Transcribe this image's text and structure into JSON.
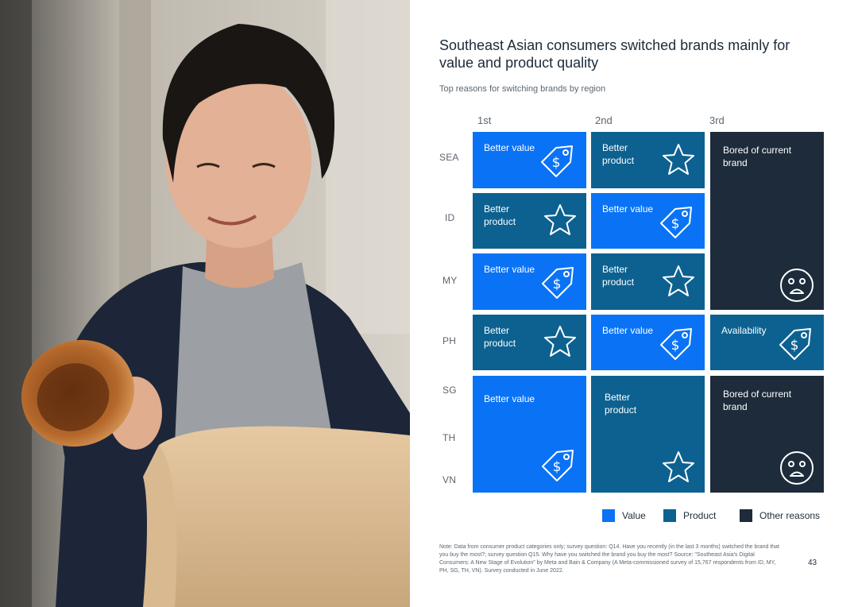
{
  "title": "Southeast Asian consumers switched brands mainly for value and product quality",
  "subtitle": "Top reasons for switching brands by region",
  "columns": [
    "1st",
    "2nd",
    "3rd"
  ],
  "rows": [
    "SEA",
    "ID",
    "MY",
    "PH",
    "SG",
    "TH",
    "VN"
  ],
  "cells": {
    "sea_1": "Better value",
    "sea_2": "Better product",
    "other_3_top": "Bored of current brand",
    "id_1": "Better product",
    "id_2": "Better value",
    "my_1": "Better value",
    "my_2": "Better product",
    "ph_1": "Better product",
    "ph_2": "Better value",
    "ph_3": "Availability",
    "sgthvn_1": "Better value",
    "sgthvn_2": "Better product",
    "sgthvn_3": "Bored of current brand"
  },
  "legend": [
    {
      "label": "Value",
      "color": "#0a73f5"
    },
    {
      "label": "Product",
      "color": "#0d6190"
    },
    {
      "label": "Other reasons",
      "color": "#1d2b3a"
    }
  ],
  "icons": {
    "value": "price-tag-icon",
    "product": "star-icon",
    "other": "frown-face-icon"
  },
  "note": "Note: Data from consumer product categories only; survey question: Q14. Have you recently (in the last 3 months) switched the brand that you buy the most?; survey question Q15. Why have you switched the brand you buy the most? Source: \"Southeast Asia's Digital Consumers: A New Stage of Evolution\" by Meta and Bain & Company (A Meta-commissioned survey of 15,767 respondents from ID, MY, PH, SG, TH, VN). Survey conducted in June 2022.",
  "page_number": "43"
}
